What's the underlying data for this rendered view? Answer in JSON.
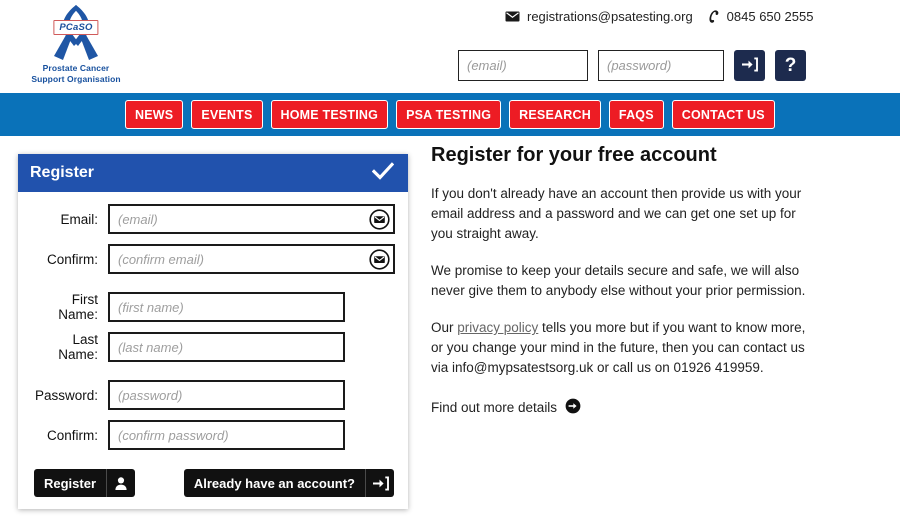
{
  "brand": {
    "badge": "PCaSO",
    "tagline_line1": "Prostate Cancer",
    "tagline_line2": "Support Organisation",
    "ribbon_color": "#1f56a5",
    "badge_border": "#d05a5a",
    "tagline_color": "#17509e"
  },
  "header": {
    "email": "registrations@psatesting.org",
    "phone": "0845 650 2555",
    "email_icon": "envelope-icon",
    "phone_icon": "phone-icon",
    "login_email_placeholder": "(email)",
    "login_email_value": "",
    "login_password_placeholder": "(password)",
    "login_password_value": "",
    "login_button_icon": "sign-in-icon",
    "help_button_label": "?",
    "button_color": "#1d2b4e"
  },
  "nav": {
    "background": "#0a72b9",
    "button_color": "#ed1c24",
    "items": [
      {
        "label": "NEWS"
      },
      {
        "label": "EVENTS"
      },
      {
        "label": "HOME TESTING"
      },
      {
        "label": "PSA TESTING"
      },
      {
        "label": "RESEARCH"
      },
      {
        "label": "FAQS"
      },
      {
        "label": "CONTACT US"
      }
    ]
  },
  "register_card": {
    "title": "Register",
    "header_color": "#2152ad",
    "check_icon": "check-icon",
    "fields": [
      {
        "label": "Email:",
        "placeholder": "(email)",
        "value": "",
        "icon": "envelope-circle-icon"
      },
      {
        "label": "Confirm:",
        "placeholder": "(confirm email)",
        "value": "",
        "icon": "envelope-circle-icon"
      },
      {
        "label": "First Name:",
        "placeholder": "(first name)",
        "value": ""
      },
      {
        "label": "Last Name:",
        "placeholder": "(last name)",
        "value": ""
      },
      {
        "label": "Password:",
        "placeholder": "(password)",
        "value": ""
      },
      {
        "label": "Confirm:",
        "placeholder": "(confirm password)",
        "value": ""
      }
    ],
    "submit_label": "Register",
    "submit_icon": "user-icon",
    "login_label": "Already have an account?",
    "login_icon": "sign-in-icon"
  },
  "main": {
    "heading": "Register for your free account",
    "paragraph1": "If you don't already have an account then provide us with your email address and a password and we can get one set up for you straight away.",
    "paragraph2": "We promise to keep your details secure and safe, we will also never give them to anybody else without your prior permission.",
    "paragraph3_before": "Our ",
    "paragraph3_link": "privacy policy",
    "paragraph3_after": " tells you more but if you want to know more, or you change your mind in the future, then you can contact us via info@mypsatestsorg.uk or call us on 01926 419959.",
    "more_label": "Find out more details",
    "more_icon": "arrow-circle-right-icon"
  }
}
